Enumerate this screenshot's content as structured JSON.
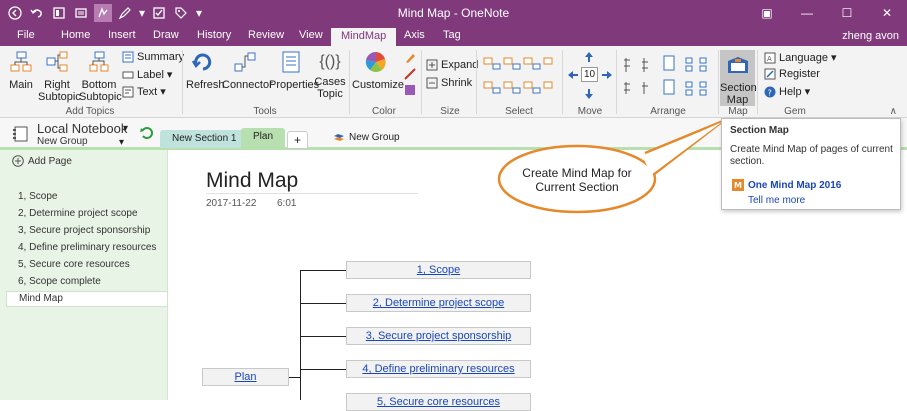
{
  "window": {
    "title": "Mind Map - OneNote",
    "user": "zheng avon",
    "controls": {
      "options": "▣",
      "minimize": "—",
      "maximize": "☐",
      "close": "✕"
    }
  },
  "qat": [
    "back-icon",
    "dock-icon",
    "lasso-icon",
    "pen-icon",
    "checkbox-icon",
    "tag-icon",
    "more-icon"
  ],
  "ribbon_tabs": [
    "File",
    "Home",
    "Insert",
    "Draw",
    "History",
    "Review",
    "View",
    "MindMap",
    "Axis",
    "Tag"
  ],
  "active_tab": "MindMap",
  "ribbon": {
    "add_topics": {
      "label": "Add Topics",
      "main": "Main",
      "right_subtopic": "Right Subtopic",
      "bottom_subtopic": "Bottom Subtopic",
      "summary": "Summary",
      "label_btn": "Label",
      "text": "Text"
    },
    "tools": {
      "label": "Tools",
      "refresh": "Refresh",
      "connector": "Connector",
      "properties": "Properties",
      "cases_topic": "Cases Topic"
    },
    "color": {
      "label": "Color",
      "customize": "Customize"
    },
    "size": {
      "label": "Size",
      "expand": "Expand",
      "shrink": "Shrink"
    },
    "select": {
      "label": "Select"
    },
    "move": {
      "label": "Move",
      "value": "10"
    },
    "arrange": {
      "label": "Arrange"
    },
    "map": {
      "label": "Map",
      "section_map": "Section Map"
    },
    "gem": {
      "label": "Gem",
      "language": "Language",
      "register": "Register",
      "help": "Help"
    }
  },
  "notebook": {
    "name": "Local Notebook",
    "group": "New Group",
    "sections": [
      {
        "label": "New Section 1",
        "color": "#bfe3dc"
      },
      {
        "label": "Plan",
        "color": "#b8dfb0"
      }
    ],
    "add_section": "+",
    "new_group": "New Group"
  },
  "pages": {
    "add_page": "Add Page",
    "items": [
      "1, Scope",
      "2, Determine project scope",
      "3, Secure project sponsorship",
      "4, Define preliminary resources",
      "5, Secure core resources",
      "6, Scope complete",
      "Mind Map"
    ],
    "selected": "Mind Map"
  },
  "page": {
    "title": "Mind Map",
    "date": "2017-11-22",
    "time": "6:01"
  },
  "mindmap": {
    "root": "Plan",
    "children": [
      "1, Scope",
      "2, Determine project scope",
      "3, Secure project sponsorship",
      "4, Define preliminary resources",
      "5, Secure core resources"
    ]
  },
  "callout": {
    "text": "Create Mind Map for Current Section"
  },
  "tooltip": {
    "title": "Section Map",
    "description": "Create Mind Map of pages of current section.",
    "link": "One Mind Map 2016",
    "more": "Tell me more"
  },
  "colors": {
    "accent": "#80397b",
    "section_plan": "#b8dfb0",
    "section_new": "#bfe3dc",
    "page_list": "#e8f4e5",
    "link": "#1a47b8"
  }
}
